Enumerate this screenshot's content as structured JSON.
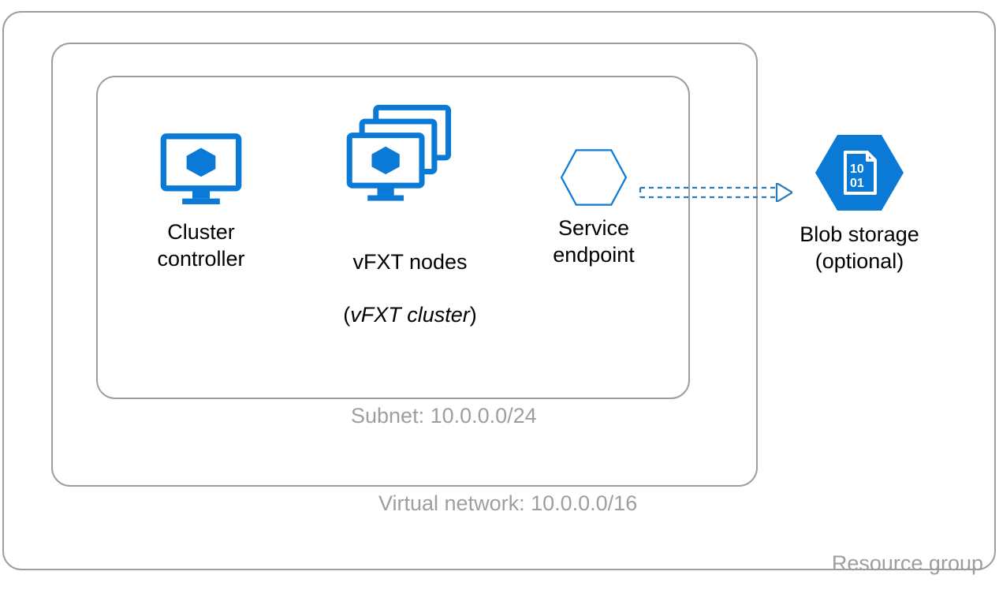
{
  "colors": {
    "accent": "#0a7ad6",
    "border_gray": "#9e9e9e",
    "dash": "#2b7bb8"
  },
  "resource_group": {
    "caption": "Resource group"
  },
  "virtual_network": {
    "caption": "Virtual network: 10.0.0.0/16"
  },
  "subnet": {
    "caption": "Subnet: 10.0.0.0/24"
  },
  "items": {
    "cluster_controller": {
      "label": "Cluster\ncontroller"
    },
    "vfxt_nodes": {
      "label_line1": "vFXT nodes",
      "label_line2_open": "(",
      "label_line2_italic": "vFXT cluster",
      "label_line2_close": ")"
    },
    "service_endpoint": {
      "label": "Service\nendpoint"
    },
    "blob_storage": {
      "label": "Blob storage\n(optional)"
    }
  }
}
